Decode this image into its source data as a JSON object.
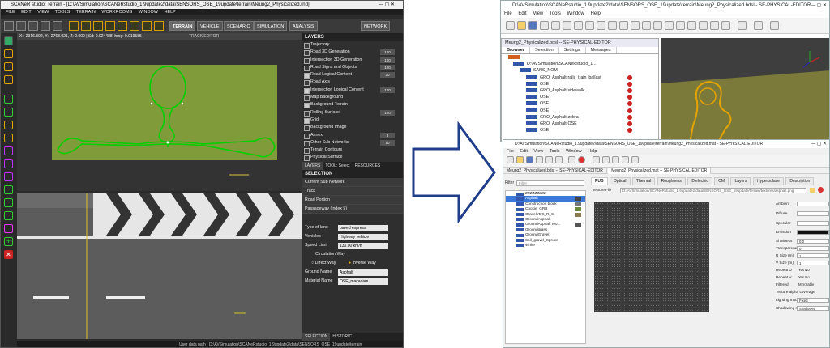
{
  "left_app": {
    "title": "SCANeR studio: Terrain - [D:\\AVSimulation\\SCANeRstudio_1.9update2\\data\\SENSORS_OSE_19update\\terrain\\Meung2_Physicalized.rnd]",
    "menu": [
      "FILE",
      "EDIT",
      "VIEW",
      "TOOLS",
      "TERRAIN",
      "WORKROOMS",
      "WINDOW",
      "HELP"
    ],
    "modes": [
      "TERRAIN",
      "VEHICLE",
      "SCENARIO",
      "SIMULATION",
      "ANALYSIS"
    ],
    "network_label": "NETWORK",
    "status_bar": "X: -2316.302, Y: -2768.021, Z: 0.000 | Sd: 0.024488, hmg: 0.019585 |",
    "track_editor_label": "TRACK EDITOR",
    "layers_title": "LAYERS",
    "layers": [
      {
        "label": "Trajectory",
        "checked": false,
        "value": ""
      },
      {
        "label": "Road 3D Generation",
        "checked": false,
        "value": "100"
      },
      {
        "label": "Intersection 3D Generation",
        "checked": false,
        "value": "100"
      },
      {
        "label": "Road Signs and Objects",
        "checked": false,
        "value": "100"
      },
      {
        "label": "Road Logical Content",
        "checked": true,
        "value": "20"
      },
      {
        "label": "Road Axis",
        "checked": false,
        "value": ""
      },
      {
        "label": "Intersection Logical Content",
        "checked": true,
        "value": "100"
      },
      {
        "label": "Map Background",
        "checked": false,
        "value": ""
      },
      {
        "label": "Background Terrain",
        "checked": true,
        "value": ""
      },
      {
        "label": "Rolling Surface",
        "checked": false,
        "value": "100"
      },
      {
        "label": "Grid",
        "checked": true,
        "value": ""
      },
      {
        "label": "Background Image",
        "checked": false,
        "value": ""
      },
      {
        "label": "Annex",
        "checked": false,
        "value": "3"
      },
      {
        "label": "Other Sub Networks",
        "checked": false,
        "value": "10"
      },
      {
        "label": "Terrain Contours",
        "checked": false,
        "value": ""
      },
      {
        "label": "Physical Surface",
        "checked": false,
        "value": ""
      }
    ],
    "panel_tabs": [
      "LAYERS",
      "TOOL: Select",
      "RESOURCES"
    ],
    "selection_title": "SELECTION",
    "selection_rows": [
      "Current Sub Network",
      "Track",
      "Road Portion",
      "Passageway (index 5)"
    ],
    "props": {
      "type_of_lane_label": "Type of lane",
      "type_of_lane_value": "paved express",
      "vehicles_label": "Vehicles",
      "vehicles_value": "Highway vehicle",
      "speed_limit_label": "Speed Limit",
      "speed_limit_value": "130.00 km/h",
      "circulation_label": "Circulation Way",
      "direct_way": "Direct Way",
      "inverse_way": "Inverse Way",
      "ground_name_label": "Ground Name",
      "ground_name_value": "Asphalt",
      "material_name_label": "Material Name",
      "material_name_value": "OSE_macadam"
    },
    "bottom_tabs": [
      "SELECTION",
      "HISTORIC"
    ],
    "user_path": "User data path : D:\\AVSimulation\\SCANeRstudio_1.9update2\\data\\SENSORS_OSE_19update\\terrain"
  },
  "right_top": {
    "title": "D:\\AVSimulation\\SCANeRstudio_1.9update2\\data\\SENSORS_OSE_19update\\terrain\\Meung2_Physicalized.bdsl - SE-PHYSICAL-EDITOR",
    "menu": [
      "File",
      "Edit",
      "View",
      "Tools",
      "Window",
      "Help"
    ],
    "tree_title": "Meung2_Physicalized.bdsl -- SE-PHYSICAL-EDITOR",
    "tabs": [
      "Browser",
      "Selection",
      "Settings",
      "Messages"
    ],
    "tree_root": "D:\\AVSimulation\\SCANeRstudio_1...",
    "tree_group": "SANS_NOM",
    "tree_items": [
      "GRO_Asphalt-rails_train_ballast",
      "OSE",
      "GRO_Asphalt-sidewalk",
      "OSE",
      "OSE",
      "OSE",
      "GRO_Asphalt-zebra",
      "GRO_Asphalt-OSE",
      "OSE"
    ]
  },
  "right_bottom": {
    "title": "D:\\AVSimulation\\SCANeRstudio_1.9update2\\data\\SENSORS_OSE_19update\\terrain\\Meung2_Physicalized.mat - SE-PHYSICAL-EDITOR",
    "menu": [
      "File",
      "Edit",
      "View",
      "Tools",
      "Window",
      "Help"
    ],
    "doc_tabs": [
      "Meung2_Physicalized.bdsl -- SE-PHYSICAL-EDITOR",
      "Meung2_Physicalized.mat -- SE-PHYSICAL-EDITOR"
    ],
    "filter_label": "Filter",
    "filter_placeholder": "Filter",
    "materials": [
      "ZZZZZZZZZ",
      "Asphalt",
      "Construction block",
      "Cookie_GRB",
      "GravelYDS_R_S",
      "GroundAsphalt",
      "GroundAsphalt Wo...",
      "Groundgrass",
      "GroundGravel",
      "Soil_gravel_Spruce",
      "White"
    ],
    "prop_tabs": [
      "PUB",
      "Optical",
      "Thermal",
      "Roughness",
      "Dielectric",
      "CM",
      "Layers",
      "Hyperbolase",
      "Description"
    ],
    "texture_label": "Texture File",
    "texture_path": "D:/AVSimulation/SCANeRstudio_1.9update2/data/SENSORS_OSE_19update/terrain/textures/asphalt.png",
    "props": [
      {
        "label": "Ambient",
        "value": ""
      },
      {
        "label": "Diffuse",
        "value": ""
      },
      {
        "label": "Specular",
        "value": ""
      },
      {
        "label": "Emission",
        "value": ""
      },
      {
        "label": "Shininess",
        "value": "0.0"
      },
      {
        "label": "Transparency",
        "value": "0"
      },
      {
        "label": "U Size (m)",
        "value": "1"
      },
      {
        "label": "V Size (m)",
        "value": "1"
      },
      {
        "label": "Repeat U",
        "value": "Yes  No"
      },
      {
        "label": "Repeat V",
        "value": "Yes  No"
      },
      {
        "label": "Filtered",
        "value": "Mirrorable"
      },
      {
        "label": "Texture alpha coverage",
        "value": ""
      },
      {
        "label": "Lighting model",
        "value": "Fixed"
      },
      {
        "label": "Shadowing model",
        "value": "Shadowed"
      }
    ]
  },
  "colors": {
    "terrain_green": "#7f9b3a",
    "road_green": "#00d000",
    "editor_yellow": "#e3a300",
    "arrow_blue": "#1f3d8a"
  }
}
